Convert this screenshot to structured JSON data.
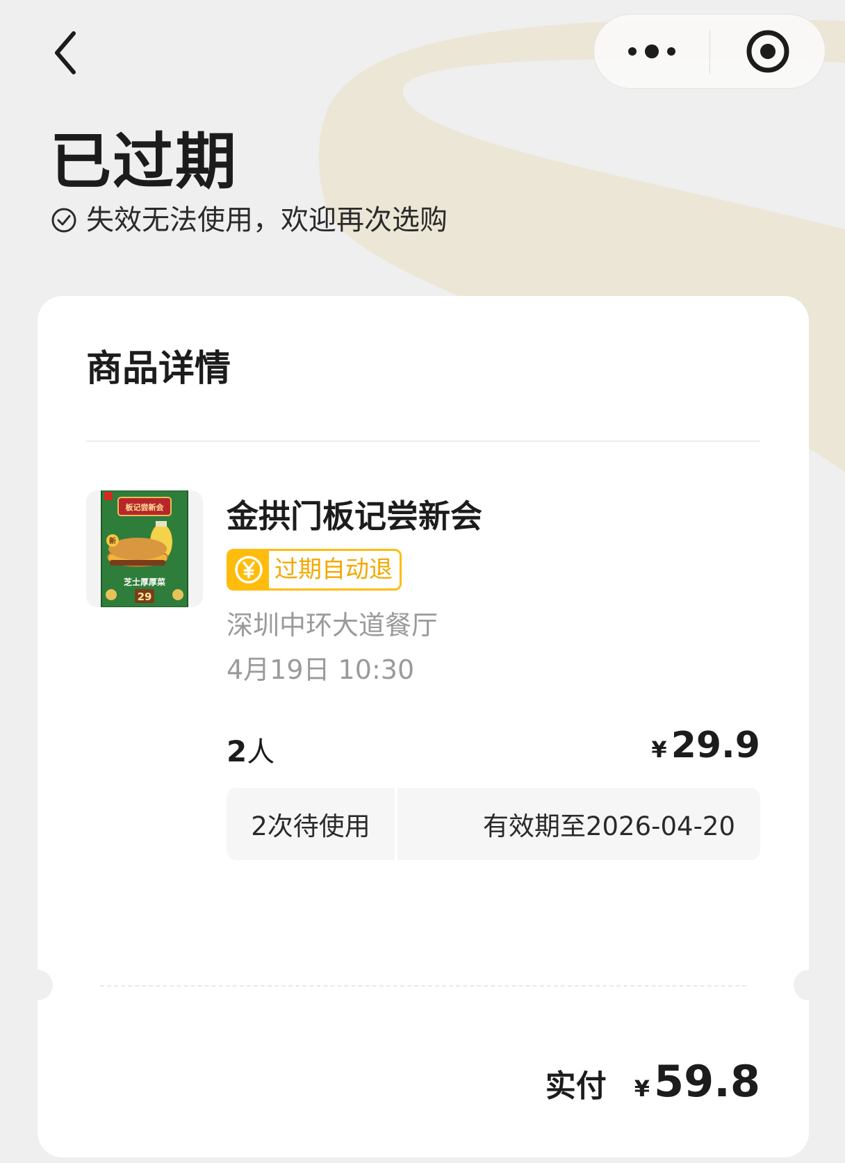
{
  "status": {
    "title": "已过期",
    "subtitle": "失效无法使用，欢迎再次选购"
  },
  "card": {
    "header": "商品详情",
    "product": {
      "name": "金拱门板记尝新会",
      "tag": "过期自动退",
      "store": "深圳中环大道餐厅",
      "time": "4月19日 10:30",
      "qty_number": "2",
      "qty_unit": "人",
      "currency": "¥",
      "price": "29.9",
      "usage": "2次待使用",
      "validity": "有效期至2026-04-20",
      "thumb_text": {
        "top": "板记尝新会",
        "badge": "新",
        "caption": "芝士厚厚菜",
        "price": "29"
      }
    },
    "total": {
      "label": "实付",
      "currency": "¥",
      "amount": "59.8"
    }
  },
  "icons": {
    "back": "chevron-left-icon",
    "more": "more-dots-icon",
    "close": "target-close-icon",
    "check": "check-circle-icon",
    "yen": "yen-coin-icon"
  },
  "colors": {
    "background": "#efefef",
    "accent": "#ffbc0d",
    "accent_text": "#f2a900",
    "swoosh": "#ece6d6",
    "muted_text": "#9a9a9a"
  }
}
